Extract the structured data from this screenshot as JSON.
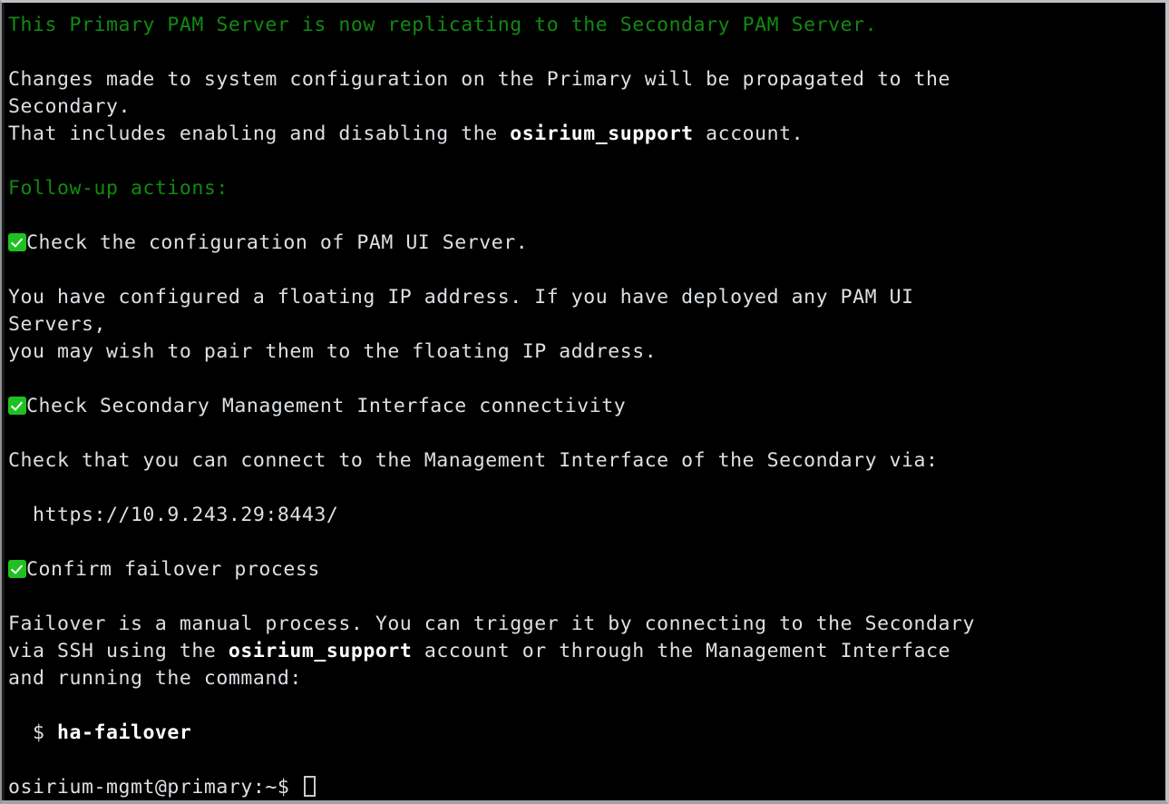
{
  "window": {
    "kind": "terminal-emulator",
    "background_color": "#000000",
    "foreground_color": "#dce0e4",
    "accent_green": "#118a11",
    "check_badge_color": "#20c020",
    "border_color": "#bcbfc4",
    "cursor_color": "#c6cacd"
  },
  "terminal": {
    "lines": [
      {
        "id": "l1",
        "style": "green",
        "text": "This Primary PAM Server is now replicating to the Secondary PAM Server."
      },
      {
        "id": "l2",
        "style": "blank",
        "text": ""
      },
      {
        "id": "l3",
        "style": "plain",
        "text": "Changes made to system configuration on the Primary will be propagated to the"
      },
      {
        "id": "l4",
        "style": "plain",
        "text": "Secondary."
      },
      {
        "id": "l5",
        "style": "mixed-bold",
        "pre": "That includes enabling and disabling the ",
        "bold": "osirium_support",
        "post": " account."
      },
      {
        "id": "l6",
        "style": "blank",
        "text": ""
      },
      {
        "id": "l7",
        "style": "green",
        "text": "Follow-up actions:"
      },
      {
        "id": "l8",
        "style": "blank",
        "text": ""
      },
      {
        "id": "l9",
        "style": "check",
        "text": "Check the configuration of PAM UI Server."
      },
      {
        "id": "l10",
        "style": "blank",
        "text": ""
      },
      {
        "id": "l11",
        "style": "plain",
        "text": "You have configured a floating IP address. If you have deployed any PAM UI"
      },
      {
        "id": "l12",
        "style": "plain",
        "text": "Servers,"
      },
      {
        "id": "l13",
        "style": "plain",
        "text": "you may wish to pair them to the floating IP address."
      },
      {
        "id": "l14",
        "style": "blank",
        "text": ""
      },
      {
        "id": "l15",
        "style": "check",
        "text": "Check Secondary Management Interface connectivity"
      },
      {
        "id": "l16",
        "style": "blank",
        "text": ""
      },
      {
        "id": "l17",
        "style": "plain",
        "text": "Check that you can connect to the Management Interface of the Secondary via:"
      },
      {
        "id": "l18",
        "style": "blank",
        "text": ""
      },
      {
        "id": "l19",
        "style": "plain",
        "text": "  https://10.9.243.29:8443/"
      },
      {
        "id": "l20",
        "style": "blank",
        "text": ""
      },
      {
        "id": "l21",
        "style": "check",
        "text": "Confirm failover process"
      },
      {
        "id": "l22",
        "style": "blank",
        "text": ""
      },
      {
        "id": "l23",
        "style": "plain",
        "text": "Failover is a manual process. You can trigger it by connecting to the Secondary"
      },
      {
        "id": "l24",
        "style": "mixed-bold",
        "pre": "via SSH using the ",
        "bold": "osirium_support",
        "post": " account or through the Management Interface"
      },
      {
        "id": "l25",
        "style": "plain",
        "text": "and running the command:"
      },
      {
        "id": "l26",
        "style": "blank",
        "text": ""
      },
      {
        "id": "l27",
        "style": "mixed-bold",
        "pre": "  $ ",
        "bold": "ha-failover",
        "post": ""
      },
      {
        "id": "l28",
        "style": "blank",
        "text": ""
      },
      {
        "id": "l29",
        "style": "prompt",
        "text": "osirium-mgmt@primary:~$ "
      }
    ]
  },
  "content": {
    "header_line": "This Primary PAM Server is now replicating to the Secondary PAM Server.",
    "section_heading": "Follow-up actions:",
    "support_account": "osirium_support",
    "management_url": "https://10.9.243.29:8443/",
    "failover_command": "ha-failover",
    "shell_prompt": "osirium-mgmt@primary:~$",
    "checklist": [
      "Check the configuration of PAM UI Server.",
      "Check Secondary Management Interface connectivity",
      "Confirm failover process"
    ]
  }
}
